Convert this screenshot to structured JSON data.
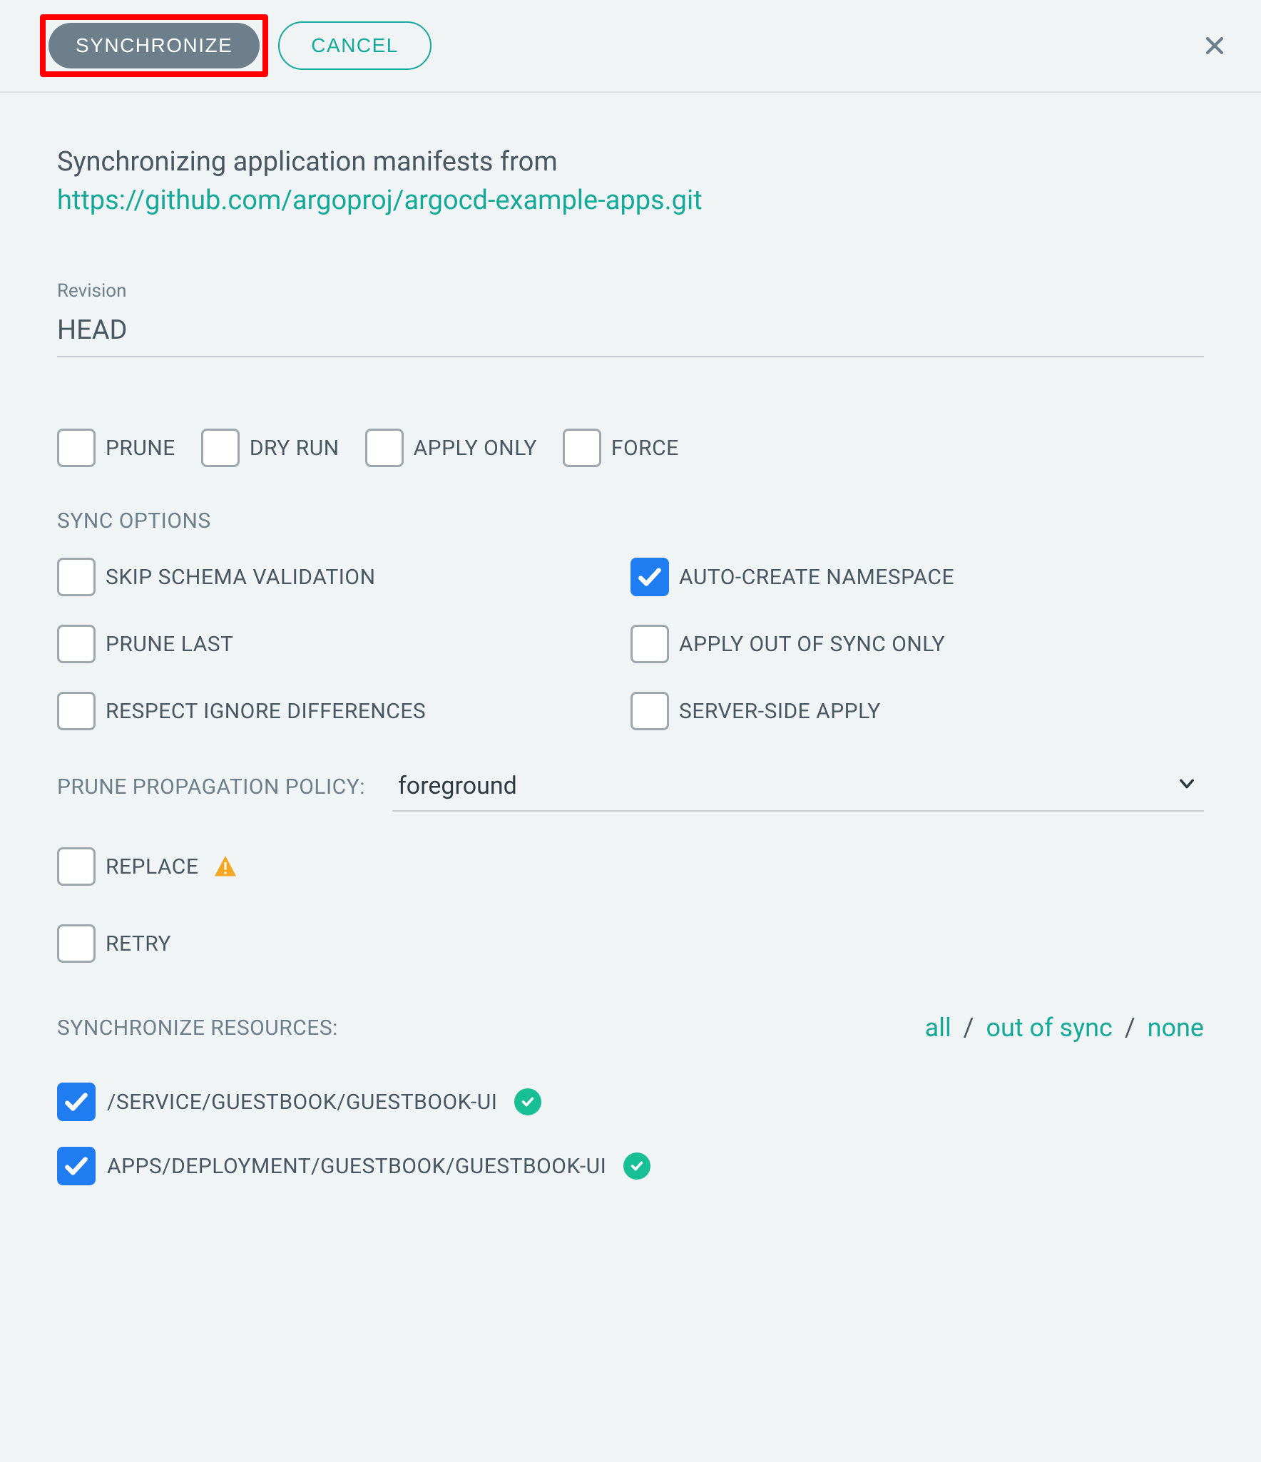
{
  "header": {
    "synchronize_label": "SYNCHRONIZE",
    "cancel_label": "CANCEL"
  },
  "intro": {
    "text": "Synchronizing application manifests from",
    "repo_url": "https://github.com/argoproj/argocd-example-apps.git"
  },
  "revision": {
    "label": "Revision",
    "value": "HEAD"
  },
  "top_options": [
    {
      "name": "prune",
      "label": "PRUNE",
      "checked": false
    },
    {
      "name": "dry-run",
      "label": "DRY RUN",
      "checked": false
    },
    {
      "name": "apply-only",
      "label": "APPLY ONLY",
      "checked": false
    },
    {
      "name": "force",
      "label": "FORCE",
      "checked": false
    }
  ],
  "sync_options_label": "SYNC OPTIONS",
  "sync_options": [
    {
      "name": "skip-schema-validation",
      "label": "SKIP SCHEMA VALIDATION",
      "checked": false
    },
    {
      "name": "auto-create-namespace",
      "label": "AUTO-CREATE NAMESPACE",
      "checked": true
    },
    {
      "name": "prune-last",
      "label": "PRUNE LAST",
      "checked": false
    },
    {
      "name": "apply-out-of-sync-only",
      "label": "APPLY OUT OF SYNC ONLY",
      "checked": false
    },
    {
      "name": "respect-ignore-differences",
      "label": "RESPECT IGNORE DIFFERENCES",
      "checked": false
    },
    {
      "name": "server-side-apply",
      "label": "SERVER-SIDE APPLY",
      "checked": false
    }
  ],
  "prune_policy": {
    "label": "PRUNE PROPAGATION POLICY:",
    "value": "foreground"
  },
  "replace": {
    "label": "REPLACE",
    "checked": false
  },
  "retry": {
    "label": "RETRY",
    "checked": false
  },
  "resources": {
    "label": "SYNCHRONIZE RESOURCES:",
    "filters": {
      "all": "all",
      "out_of_sync": "out of sync",
      "none": "none"
    },
    "items": [
      {
        "label": "/SERVICE/GUESTBOOK/GUESTBOOK-UI",
        "checked": true,
        "synced": true
      },
      {
        "label": "APPS/DEPLOYMENT/GUESTBOOK/GUESTBOOK-UI",
        "checked": true,
        "synced": true
      }
    ]
  },
  "colors": {
    "accent": "#15a99a",
    "checkbox_checked": "#1f7df1",
    "status_ok": "#18be94",
    "warning": "#f5a623",
    "highlight_border": "#ff0000"
  }
}
